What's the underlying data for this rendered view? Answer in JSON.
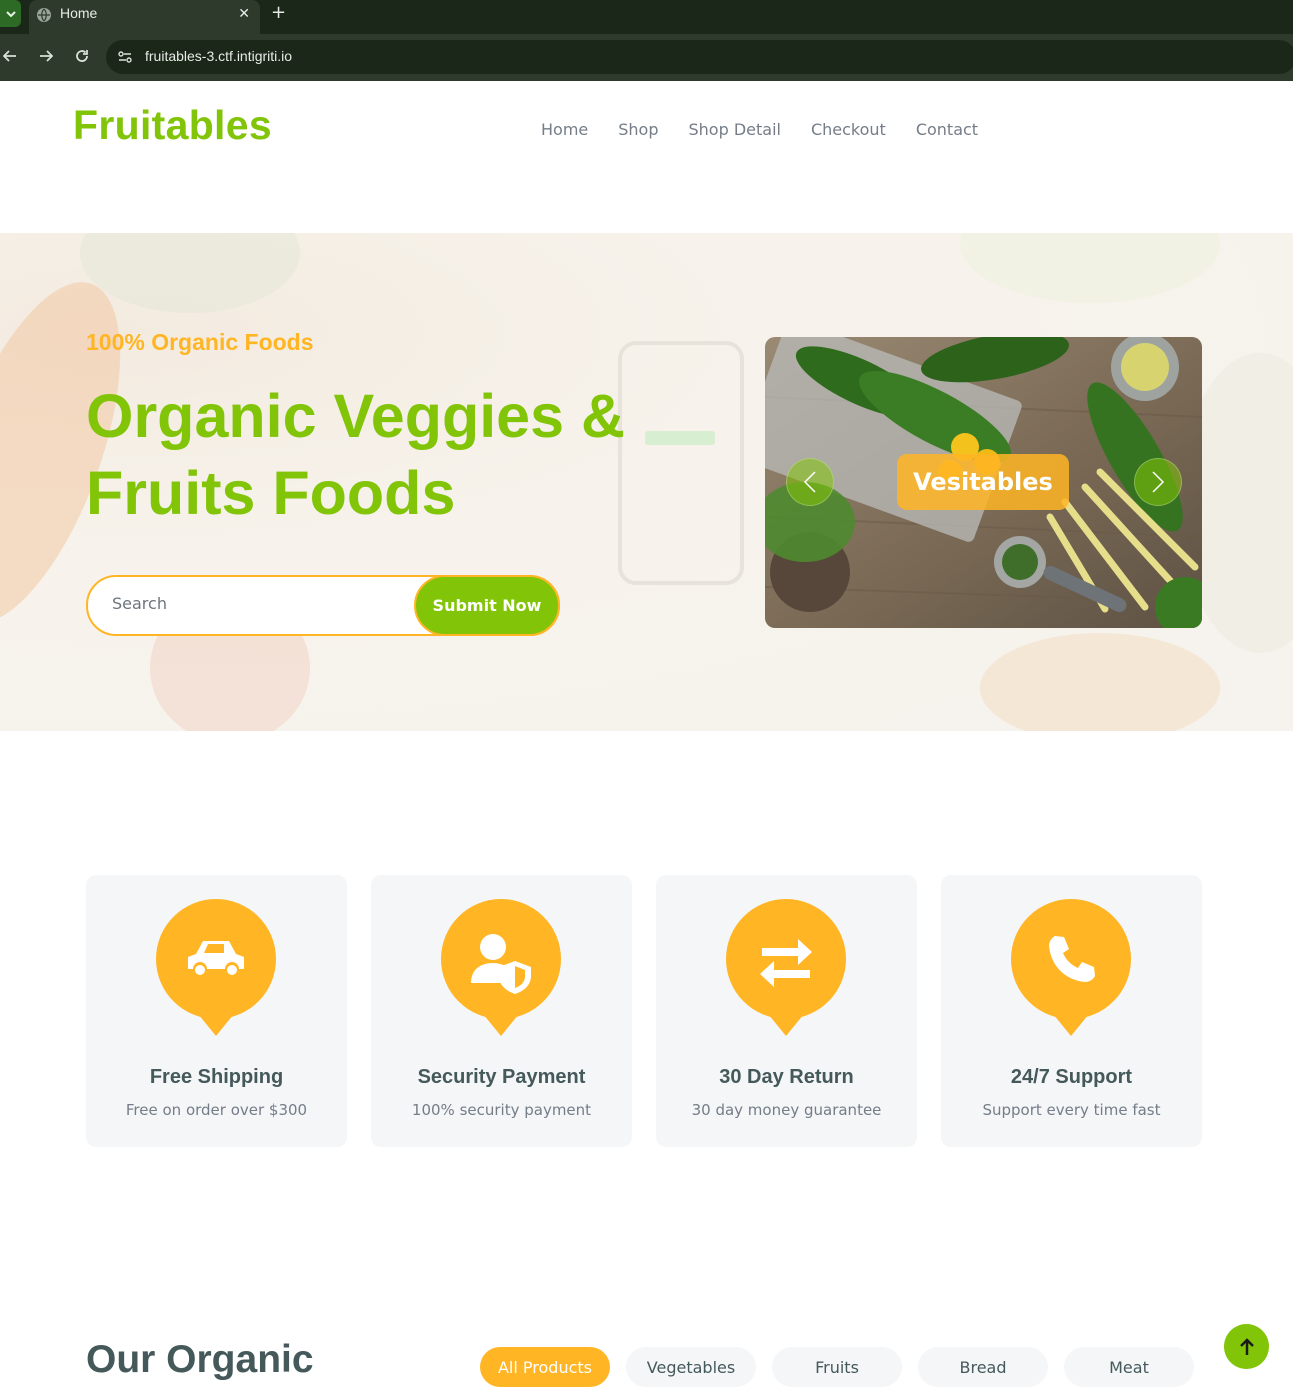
{
  "browser": {
    "tab_title": "Home",
    "url": "fruitables-3.ctf.intigriti.io",
    "new_tab_icon": "plus-icon",
    "close_icon": "close-icon"
  },
  "header": {
    "logo": "Fruitables",
    "nav": [
      "Home",
      "Shop",
      "Shop Detail",
      "Checkout",
      "Contact"
    ]
  },
  "hero": {
    "subtitle": "100% Organic Foods",
    "title": "Organic Veggies & Fruits Foods",
    "search": {
      "placeholder": "Search",
      "button": "Submit Now"
    },
    "carousel": {
      "caption": "Vesitables"
    }
  },
  "features": [
    {
      "icon": "car-icon",
      "title": "Free Shipping",
      "desc": "Free on order over $300"
    },
    {
      "icon": "user-shield-icon",
      "title": "Security Payment",
      "desc": "100% security payment"
    },
    {
      "icon": "exchange-icon",
      "title": "30 Day Return",
      "desc": "30 day money guarantee"
    },
    {
      "icon": "phone-icon",
      "title": "24/7 Support",
      "desc": "Support every time fast"
    }
  ],
  "products": {
    "title": "Our Organic",
    "filters": [
      "All Products",
      "Vegetables",
      "Fruits",
      "Bread",
      "Meat"
    ],
    "active_filter": "All Products"
  },
  "colors": {
    "primary": "#81c408",
    "secondary": "#ffb524",
    "dark": "#45595b"
  }
}
